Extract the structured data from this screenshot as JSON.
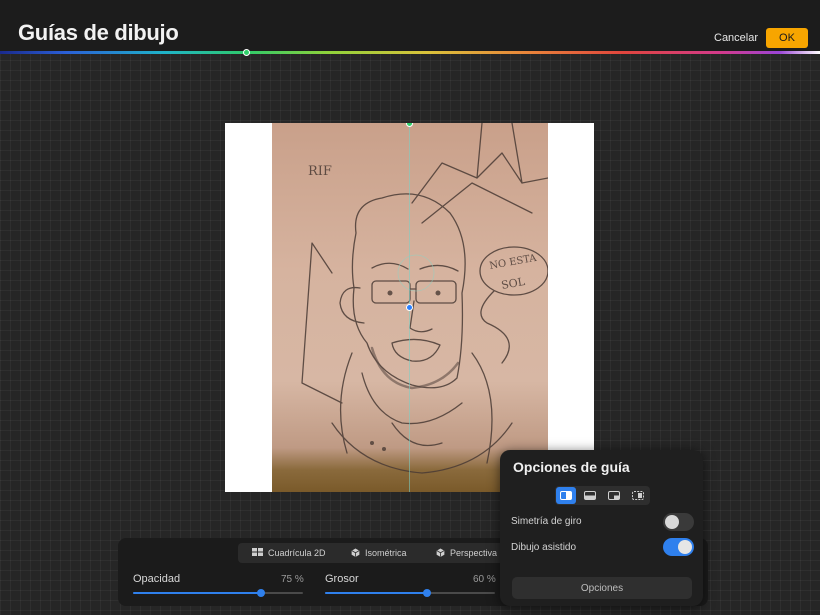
{
  "header": {
    "title": "Guías de dibujo",
    "cancel_label": "Cancelar",
    "ok_label": "OK"
  },
  "colors": {
    "accent_ok": "#f7a500",
    "accent_blue": "#2f80ed",
    "symmetry_guide": "#2fd06a"
  },
  "guide_tabs": [
    {
      "label": "Cuadrícula 2D",
      "icon": "grid-icon"
    },
    {
      "label": "Isométrica",
      "icon": "isometric-icon"
    },
    {
      "label": "Perspectiva",
      "icon": "perspective-icon"
    }
  ],
  "sliders": {
    "opacity": {
      "label": "Opacidad",
      "value_text": "75 %",
      "value": 0.75
    },
    "thickness": {
      "label": "Grosor",
      "value_text": "60 %",
      "value": 0.6
    }
  },
  "guide_options": {
    "title": "Opciones de guía",
    "symmetry_modes": [
      "vertical-symmetry-icon",
      "horizontal-symmetry-icon",
      "quadrant-symmetry-icon",
      "radial-symmetry-icon"
    ],
    "selected_mode": "vertical-symmetry-icon",
    "rotational_symmetry": {
      "label": "Simetría de giro",
      "enabled": false
    },
    "assisted_drawing": {
      "label": "Dibujo asistido",
      "enabled": true
    },
    "options_button": "Opciones"
  },
  "sketch_text": {
    "note_top": "RIF",
    "speech_line1": "NO ESTA",
    "speech_line2": "SOL"
  }
}
